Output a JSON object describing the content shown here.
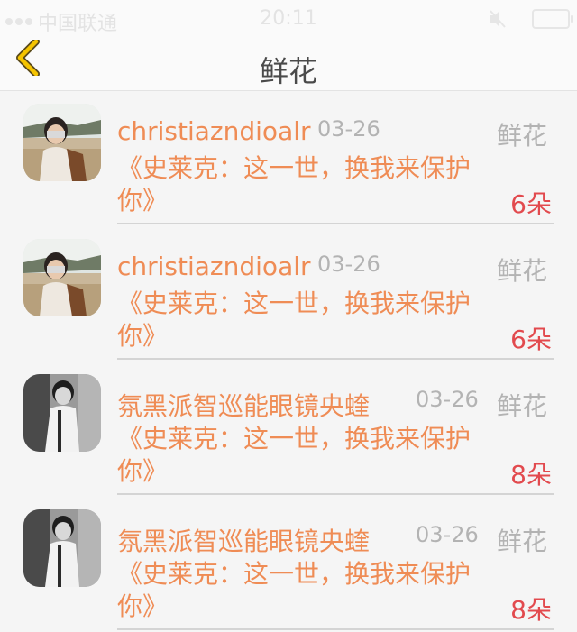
{
  "status_bar": {
    "carrier": "中国联通",
    "time": "20:11"
  },
  "nav": {
    "title": "鲜花"
  },
  "items": [
    {
      "username": "christiazndioalr",
      "date": "03-26",
      "category": "鲜花",
      "message": "《史莱克：这一世，换我来保护你》",
      "count": "6朵"
    },
    {
      "username": "christiazndioalr",
      "date": "03-26",
      "category": "鲜花",
      "message": "《史莱克：这一世，换我来保护你》",
      "count": "6朵"
    },
    {
      "username": "氛黑派智巡能眼镜央蝰",
      "date": "03-26",
      "category": "鲜花",
      "message": "《史莱克：这一世，换我来保护你》",
      "count": "8朵"
    },
    {
      "username": "氛黑派智巡能眼镜央蝰",
      "date": "03-26",
      "category": "鲜花",
      "message": "《史莱克：这一世，换我来保护你》",
      "count": "8朵"
    }
  ],
  "colors": {
    "accent": "#ef8c55",
    "count": "#e24a4e",
    "muted": "#b3b3b3",
    "back_icon": "#f5c400"
  }
}
